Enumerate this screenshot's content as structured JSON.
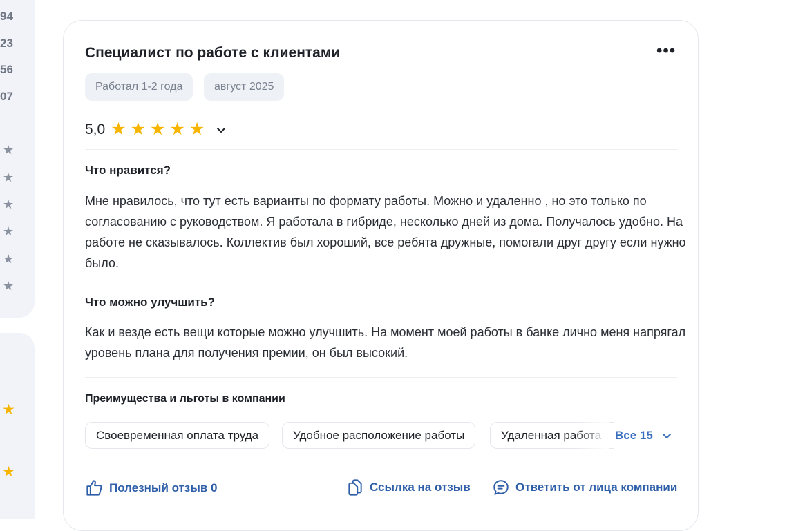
{
  "left_panel": {
    "numbers": [
      "94",
      "23",
      "56",
      "07"
    ],
    "grey_stars": [
      "★",
      "★",
      "★",
      "★",
      "★",
      "★"
    ],
    "yellow_stars": [
      "★",
      "★"
    ]
  },
  "review": {
    "title": "Специалист по работе с клиентами",
    "more_icon": "•••",
    "tags": [
      "Работал 1-2 года",
      "август 2025"
    ],
    "rating": {
      "value": "5,0",
      "stars": 5,
      "star_color": "#f7b500"
    },
    "likes": {
      "heading": "Что нравится?",
      "text": "Мне нравилось, что тут есть варианты по формату работы. Можно и удаленно , но это только по согласованию с руководством. Я работала в гибриде, несколько дней из дома. Получалось удобно. На работе не сказывалось. Коллектив был хороший, все ребята дружные, помогали друг другу если нужно было."
    },
    "improve": {
      "heading": "Что можно улучшить?",
      "text": "Как и везде есть вещи которые можно улучшить. На момент моей работы в банке лично меня напрягал уровень плана для получения премии, он был высокий."
    },
    "benefits": {
      "heading": "Преимущества и льготы в компании",
      "items": [
        "Своевременная оплата труда",
        "Удобное расположение работы",
        "Удаленная работа"
      ],
      "all_label": "Все 15"
    },
    "actions": {
      "helpful": "Полезный отзыв 0",
      "link": "Ссылка на отзыв",
      "reply": "Ответить от лица компании"
    },
    "accent_color": "#2f5fa8"
  }
}
